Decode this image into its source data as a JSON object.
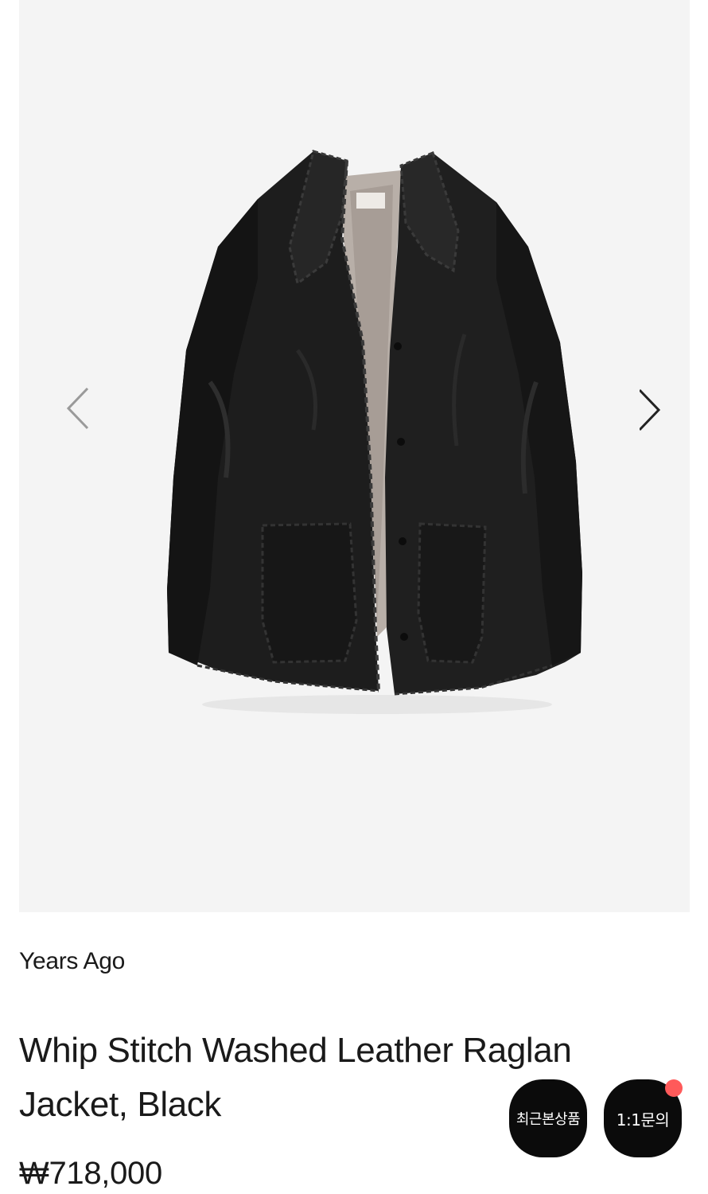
{
  "gallery": {
    "prev_icon": "chevron-left-icon",
    "next_icon": "chevron-right-icon",
    "image_subject": "black leather raglan jacket",
    "background_color": "#f4f4f4"
  },
  "product": {
    "brand": "Years Ago",
    "title": "Whip Stitch Washed Leather Raglan Jacket, Black",
    "price": "₩718,000"
  },
  "floating_buttons": {
    "recent": "최근본상품",
    "inquiry": "1:1문의",
    "notification_color": "#ff5a5a"
  },
  "colors": {
    "button_bg": "#0b0b0b",
    "text": "#1a1a1a"
  }
}
